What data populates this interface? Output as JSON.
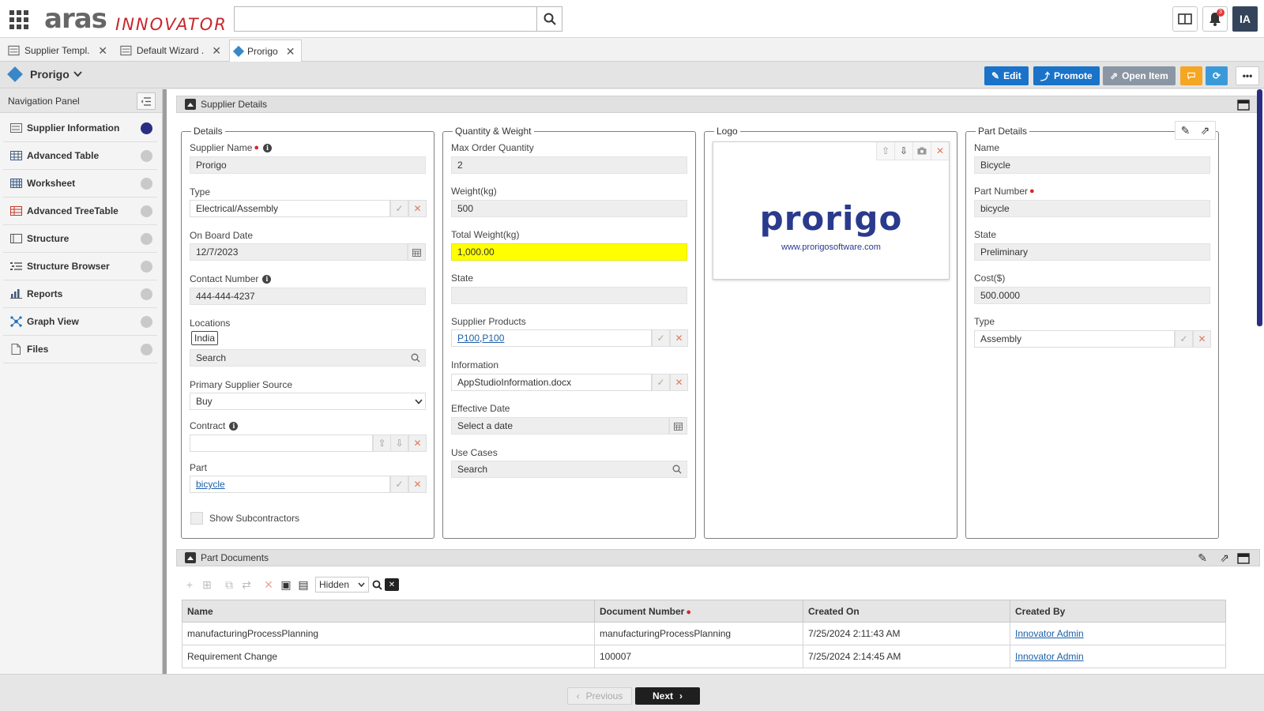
{
  "header": {
    "logo_main": "aras",
    "logo_sub": "INNOVATOR",
    "search_value": "",
    "avatar_initials": "IA",
    "notification_count": "3"
  },
  "tabs": [
    {
      "label": "Supplier Templ..."
    },
    {
      "label": "Default Wizard ..."
    },
    {
      "label": "Prorigo"
    }
  ],
  "item_bar": {
    "title": "Prorigo",
    "actions": {
      "edit": "Edit",
      "promote": "Promote",
      "open_item": "Open Item"
    }
  },
  "nav": {
    "title": "Navigation Panel",
    "items": [
      {
        "label": "Supplier Information",
        "icon": "form-icon"
      },
      {
        "label": "Advanced Table",
        "icon": "table-icon"
      },
      {
        "label": "Worksheet",
        "icon": "worksheet-icon"
      },
      {
        "label": "Advanced TreeTable",
        "icon": "treetable-icon"
      },
      {
        "label": "Structure",
        "icon": "structure-icon"
      },
      {
        "label": "Structure Browser",
        "icon": "list-icon"
      },
      {
        "label": "Reports",
        "icon": "chart-icon"
      },
      {
        "label": "Graph View",
        "icon": "graph-icon"
      },
      {
        "label": "Files",
        "icon": "file-icon"
      }
    ]
  },
  "supplier_details": {
    "title": "Supplier Details",
    "details": {
      "legend": "Details",
      "supplier_name_label": "Supplier Name",
      "supplier_name": "Prorigo",
      "type_label": "Type",
      "type": "Electrical/Assembly",
      "onboard_label": "On Board Date",
      "onboard": "12/7/2023",
      "contact_label": "Contact Number",
      "contact": "444-444-4237",
      "locations_label": "Locations",
      "location_chip": "India",
      "locations_placeholder": "Search",
      "primary_source_label": "Primary Supplier Source",
      "primary_source": "Buy",
      "contract_label": "Contract",
      "contract": "",
      "part_label": "Part",
      "part": "bicycle",
      "show_subcontractors": "Show Subcontractors"
    },
    "quantity": {
      "legend": "Quantity & Weight",
      "max_order_label": "Max Order Quantity",
      "max_order": "2",
      "weight_label": "Weight(kg)",
      "weight": "500",
      "total_weight_label": "Total Weight(kg)",
      "total_weight": "1,000.00",
      "state_label": "State",
      "state": "",
      "products_label": "Supplier Products",
      "product1": "P100",
      "product_sep": ", ",
      "product2": "P100",
      "information_label": "Information",
      "information": "AppStudioInformation.docx",
      "effective_label": "Effective Date",
      "effective_placeholder": "Select a date",
      "use_cases_label": "Use Cases",
      "use_cases_placeholder": "Search"
    },
    "logo": {
      "legend": "Logo",
      "word": "prorigo",
      "url": "www.prorigosoftware.com"
    },
    "part": {
      "legend": "Part Details",
      "name_label": "Name",
      "name": "Bicycle",
      "number_label": "Part Number",
      "number": "bicycle",
      "state_label": "State",
      "state": "Preliminary",
      "cost_label": "Cost($)",
      "cost": "500.0000",
      "type_label": "Type",
      "type": "Assembly"
    }
  },
  "part_documents": {
    "title": "Part Documents",
    "filter_mode": "Hidden",
    "columns": [
      "Name",
      "Document Number",
      "Created On",
      "Created By"
    ],
    "rows": [
      [
        "manufacturingProcessPlanning",
        "manufacturingProcessPlanning",
        "7/25/2024 2:11:43 AM",
        "Innovator Admin"
      ],
      [
        "Requirement Change",
        "100007",
        "7/25/2024 2:14:45 AM",
        "Innovator Admin"
      ]
    ]
  },
  "footer": {
    "previous": "Previous",
    "next": "Next"
  },
  "colors": {
    "accent": "#1a73c8",
    "orange": "#f5a623",
    "highlight": "#ffff00",
    "nav_active": "#2a2e82"
  }
}
